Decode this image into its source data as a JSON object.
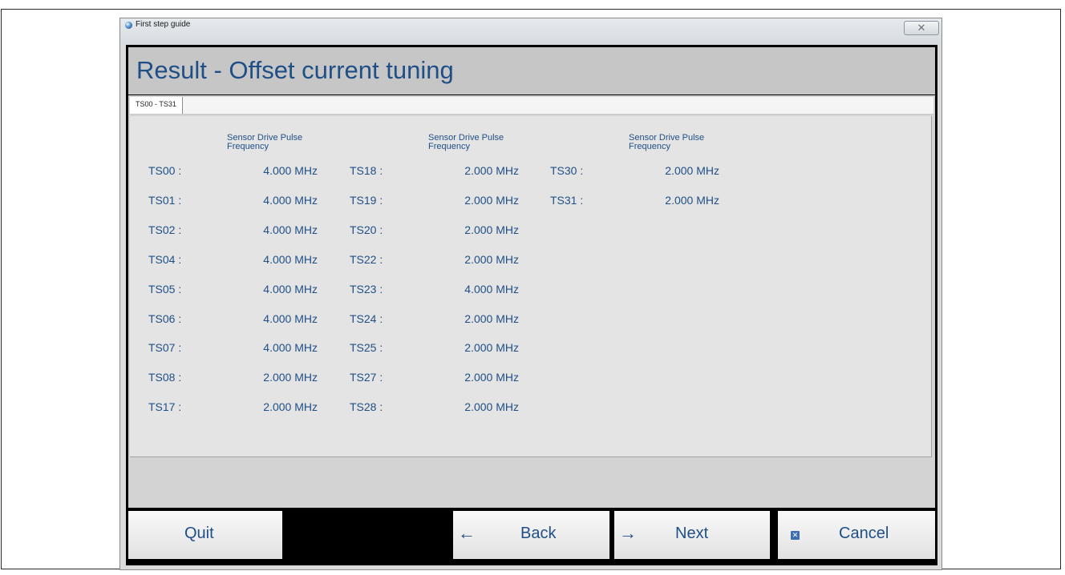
{
  "window": {
    "title": "First step guide",
    "close_glyph": "✕"
  },
  "page": {
    "title": "Result - Offset current tuning"
  },
  "tabs": [
    {
      "label": "TS00 - TS31",
      "active": true
    }
  ],
  "columns": [
    {
      "header": "Sensor Drive Pulse Frequency",
      "rows": [
        {
          "label": "TS00 :",
          "value": "4.000 MHz"
        },
        {
          "label": "TS01 :",
          "value": "4.000 MHz"
        },
        {
          "label": "TS02 :",
          "value": "4.000 MHz"
        },
        {
          "label": "TS04 :",
          "value": "4.000 MHz"
        },
        {
          "label": "TS05 :",
          "value": "4.000 MHz"
        },
        {
          "label": "TS06 :",
          "value": "4.000 MHz"
        },
        {
          "label": "TS07 :",
          "value": "4.000 MHz"
        },
        {
          "label": "TS08 :",
          "value": "2.000 MHz"
        },
        {
          "label": "TS17 :",
          "value": "2.000 MHz"
        }
      ]
    },
    {
      "header": "Sensor Drive Pulse Frequency",
      "rows": [
        {
          "label": "TS18 :",
          "value": "2.000 MHz"
        },
        {
          "label": "TS19 :",
          "value": "2.000 MHz"
        },
        {
          "label": "TS20 :",
          "value": "2.000 MHz"
        },
        {
          "label": "TS22 :",
          "value": "2.000 MHz"
        },
        {
          "label": "TS23 :",
          "value": "4.000 MHz"
        },
        {
          "label": "TS24 :",
          "value": "2.000 MHz"
        },
        {
          "label": "TS25 :",
          "value": "2.000 MHz"
        },
        {
          "label": "TS27 :",
          "value": "2.000 MHz"
        },
        {
          "label": "TS28 :",
          "value": "2.000 MHz"
        }
      ]
    },
    {
      "header": "Sensor Drive Pulse Frequency",
      "rows": [
        {
          "label": "TS30 :",
          "value": "2.000 MHz"
        },
        {
          "label": "TS31 :",
          "value": "2.000 MHz"
        }
      ]
    }
  ],
  "buttons": {
    "quit": {
      "label": "Quit"
    },
    "back": {
      "label": "Back",
      "icon": "arrow-left-icon",
      "glyph": "←"
    },
    "next": {
      "label": "Next",
      "icon": "arrow-right-icon",
      "glyph": "→"
    },
    "cancel": {
      "label": "Cancel",
      "icon": "cancel-icon",
      "glyph": "✕"
    }
  },
  "colors": {
    "accent_text": "#1f4f86",
    "panel": "#e4e4e4",
    "header": "#c6c6c6"
  }
}
